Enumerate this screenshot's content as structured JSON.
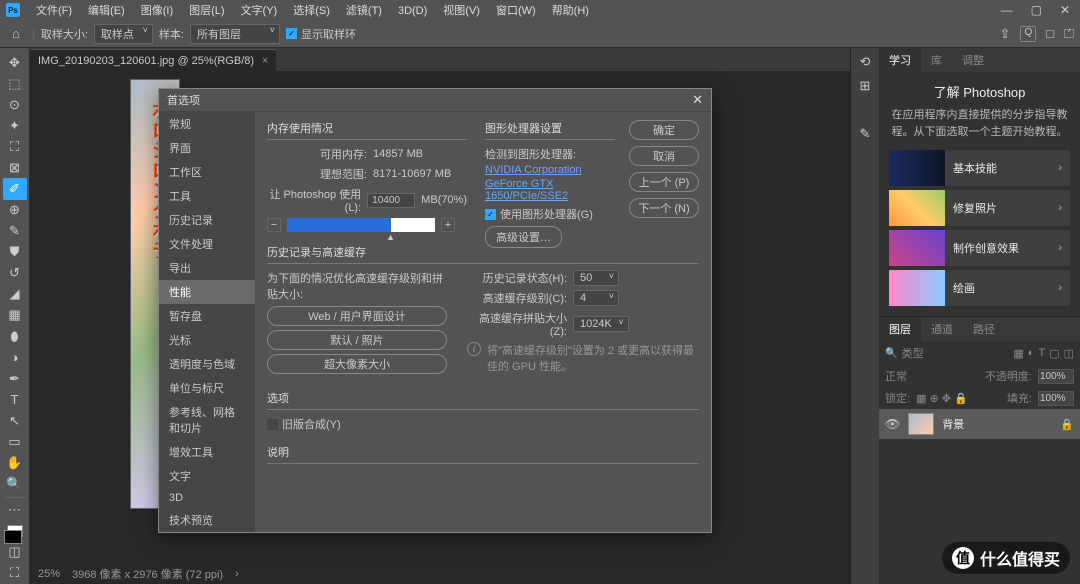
{
  "menu": {
    "items": [
      "文件(F)",
      "编辑(E)",
      "图像(I)",
      "图层(L)",
      "文字(Y)",
      "选择(S)",
      "滤镜(T)",
      "3D(D)",
      "视图(V)",
      "窗口(W)",
      "帮助(H)"
    ]
  },
  "optbar": {
    "sampleSizeLabel": "取样大小:",
    "sampleSizeValue": "取样点",
    "sampleLabel": "样本:",
    "sampleValue": "所有图层",
    "showRing": "显示取样环"
  },
  "document": {
    "tabTitle": "IMG_20190203_120601.jpg @ 25%(RGB/8)",
    "zoom": "25%",
    "status": "3968 像素 x 2976 像素 (72 ppi)"
  },
  "dialog": {
    "title": "首选项",
    "nav": [
      "常规",
      "界面",
      "工作区",
      "工具",
      "历史记录",
      "文件处理",
      "导出",
      "性能",
      "暂存盘",
      "光标",
      "透明度与色域",
      "单位与标尺",
      "参考线、网格和切片",
      "增效工具",
      "文字",
      "3D",
      "技术预览"
    ],
    "navSelectedIndex": 7,
    "buttons": {
      "ok": "确定",
      "cancel": "取消",
      "prev": "上一个 (P)",
      "next": "下一个 (N)"
    },
    "memory": {
      "title": "内存使用情况",
      "availLabel": "可用内存:",
      "availValue": "14857 MB",
      "idealLabel": "理想范围:",
      "idealValue": "8171-10697 MB",
      "useLabel": "让 Photoshop 使用 (L):",
      "useValue": "10400",
      "usePct": "MB(70%)"
    },
    "gpu": {
      "title": "图形处理器设置",
      "detectedLabel": "检测到图形处理器:",
      "vendor": "NVIDIA Corporation",
      "model": "GeForce GTX 1650/PCIe/SSE2",
      "useGpu": "使用图形处理器(G)",
      "advanced": "高级设置…"
    },
    "history": {
      "title": "历史记录与高速缓存",
      "optimizeLabel": "为下面的情况优化高速缓存级别和拼贴大小:",
      "presets": [
        "Web / 用户界面设计",
        "默认 / 照片",
        "超大像素大小"
      ],
      "statesLabel": "历史记录状态(H):",
      "statesValue": "50",
      "levelsLabel": "高速缓存级别(C):",
      "levelsValue": "4",
      "tileLabel": "高速缓存拼贴大小(Z):",
      "tileValue": "1024K",
      "note": "将\"高速缓存级别\"设置为 2 或更高以获得最佳的 GPU 性能。"
    },
    "options": {
      "title": "选项",
      "legacy": "旧版合成(Y)"
    },
    "desc": {
      "title": "说明"
    }
  },
  "learn": {
    "tabs": [
      "学习",
      "库",
      "调整"
    ],
    "title": "了解 Photoshop",
    "subtitle": "在应用程序内直接提供的分步指导教程。从下面选取一个主题开始教程。",
    "cards": [
      "基本技能",
      "修复照片",
      "制作创意效果",
      "绘画"
    ]
  },
  "layers": {
    "tabs": [
      "图层",
      "通道",
      "路径"
    ],
    "kind": "类型",
    "blend": "正常",
    "opacityLabel": "不透明度:",
    "opacityValue": "100%",
    "lockLabel": "锁定:",
    "fillLabel": "填充:",
    "fillValue": "100%",
    "bgLayer": "背景"
  },
  "watermark": "什么值得买"
}
